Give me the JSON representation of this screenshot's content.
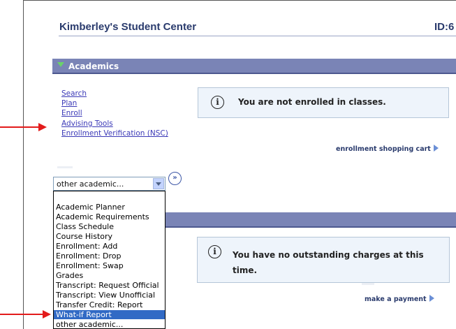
{
  "header": {
    "title": "Kimberley's Student Center",
    "id_label": "ID:6"
  },
  "academics": {
    "section_title": "Academics",
    "links": [
      "Search",
      "Plan",
      "Enroll",
      "Advising Tools",
      "Enrollment Verification (NSC)"
    ],
    "enrollment_message": "You are not enrolled in classes.",
    "shopping_cart_link": "enrollment shopping cart"
  },
  "other_academic_select": {
    "selected": "other academic...",
    "go_label": "»",
    "options": [
      "Academic Planner",
      "Academic Requirements",
      "Class Schedule",
      "Course History",
      "Enrollment: Add",
      "Enrollment: Drop",
      "Enrollment: Swap",
      "Grades",
      "Transcript: Request Official",
      "Transcript: View Unofficial",
      "Transfer Credit: Report",
      "What-if Report",
      "other academic..."
    ],
    "highlighted_option": "What-if Report"
  },
  "finances": {
    "message_line1": "You have no outstanding charges at this",
    "message_line2": "time.",
    "payment_link": "make a payment"
  },
  "colors": {
    "accent_header": "#7a84b6",
    "link": "#3b39b7",
    "annotation_arrow": "#e31b1b",
    "selection": "#316ac5"
  },
  "icons": [
    "info-icon",
    "triangle-down-icon",
    "play-arrow-icon",
    "double-chevron-icon"
  ]
}
